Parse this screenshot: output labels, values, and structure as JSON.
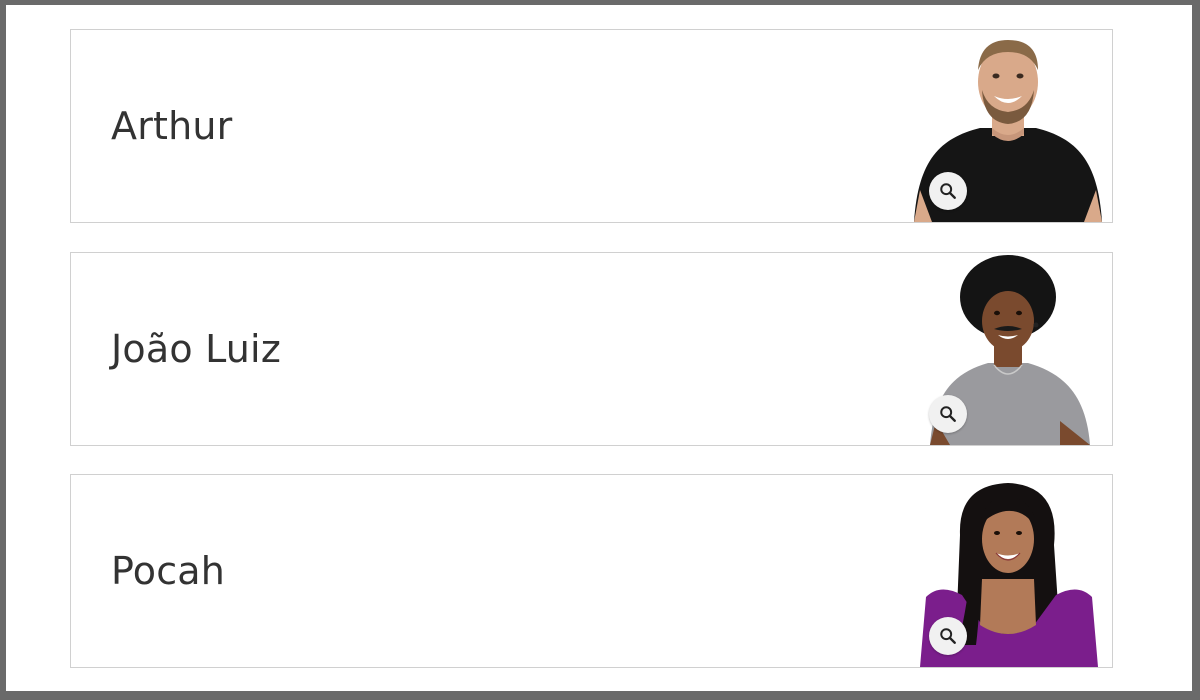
{
  "participants": [
    {
      "name": "Arthur",
      "photo_icon": "portrait-man-black-shirt",
      "zoom_icon": "zoom-icon",
      "shirt_color": "#151515",
      "skin_color": "#d9a98a",
      "hair_color": "#8a6a48"
    },
    {
      "name": "João Luiz",
      "photo_icon": "portrait-man-gray-shirt",
      "zoom_icon": "zoom-icon",
      "shirt_color": "#9a9a9e",
      "skin_color": "#7a4a2e",
      "hair_color": "#141414"
    },
    {
      "name": "Pocah",
      "photo_icon": "portrait-woman-purple-top",
      "zoom_icon": "zoom-icon",
      "shirt_color": "#7b1e8c",
      "skin_color": "#b27a58",
      "hair_color": "#141010"
    }
  ]
}
